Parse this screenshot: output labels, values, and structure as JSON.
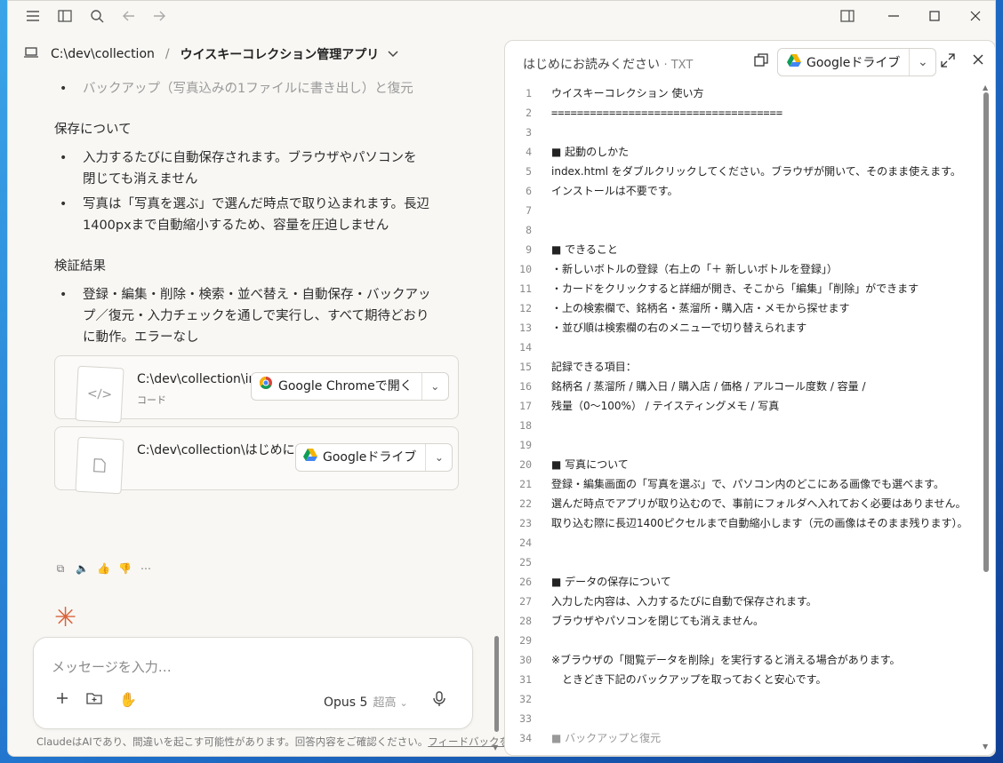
{
  "titlebar": {
    "menu_icon": "hamburger-icon",
    "sidebar_icon": "sidebar-toggle-icon",
    "search_icon": "search-icon",
    "back_icon": "arrow-left-icon",
    "forward_icon": "arrow-right-icon",
    "layout_icon": "split-view-icon",
    "minimize_icon": "minimize-icon",
    "maximize_icon": "maximize-icon",
    "close_icon": "close-icon"
  },
  "breadcrumb": {
    "path": "C:\\dev\\collection",
    "separator": "/",
    "project": "ウイスキーコレクション管理アプリ"
  },
  "chat": {
    "top_bullet": "バックアップ（写真込みの1ファイルに書き出し）と復元",
    "save_heading": "保存について",
    "save_bullets": [
      "入力するたびに自動保存されます。ブラウザやパソコンを閉じても消えません",
      "写真は「写真を選ぶ」で選んだ時点で取り込まれます。長辺1400pxまで自動縮小するため、容量を圧迫しません"
    ],
    "verify_heading": "検証結果",
    "verify_bullets": [
      "登録・編集・削除・検索・並べ替え・自動保存・バックアップ／復元・入力チェックを通しで実行し、すべて期待どおりに動作。エラーなし"
    ],
    "cards": [
      {
        "name": "C:\\dev\\collection\\in",
        "sub": "コード",
        "button": "Google Chromeで開く"
      },
      {
        "name": "C:\\dev\\collection\\はじめに…",
        "sub": "",
        "button": "Googleドライブ"
      }
    ]
  },
  "composer": {
    "placeholder": "メッセージを入力…",
    "model": "Opus 5",
    "effort": "超高"
  },
  "disclaimer": {
    "text": "ClaudeはAIであり、間違いを起こす可能性があります。回答内容をご確認ください。",
    "feedback": "フィードバックを送信"
  },
  "panel": {
    "title": "はじめにお読みください",
    "ext": "· TXT",
    "drive_button": "Googleドライブ",
    "lines": [
      "ウイスキーコレクション 使い方",
      "====================================",
      "",
      "■ 起動のしかた",
      "index.html をダブルクリックしてください。ブラウザが開いて、そのまま使えます。",
      "インストールは不要です。",
      "",
      "",
      "■ できること",
      "・新しいボトルの登録（右上の「＋ 新しいボトルを登録」）",
      "・カードをクリックすると詳細が開き、そこから「編集」「削除」ができます",
      "・上の検索欄で、銘柄名・蒸溜所・購入店・メモから探せます",
      "・並び順は検索欄の右のメニューで切り替えられます",
      "",
      "記録できる項目：",
      "銘柄名 / 蒸溜所 / 購入日 / 購入店 / 価格 / アルコール度数 / 容量 /",
      "残量（0〜100%） / テイスティングメモ / 写真",
      "",
      "",
      "■ 写真について",
      "登録・編集画面の「写真を選ぶ」で、パソコン内のどこにある画像でも選べます。",
      "選んだ時点でアプリが取り込むので、事前にフォルダへ入れておく必要はありません。",
      "取り込む際に長辺1400ピクセルまで自動縮小します（元の画像はそのまま残ります）。",
      "",
      "",
      "■ データの保存について",
      "入力した内容は、入力するたびに自動で保存されます。",
      "ブラウザやパソコンを閉じても消えません。",
      "",
      "※ブラウザの「閲覧データを削除」を実行すると消える場合があります。",
      "　ときどき下記のバックアップを取っておくと安心です。",
      "",
      "",
      "■ バックアップと復元"
    ]
  },
  "colors": {
    "accent": "#d9653a",
    "background": "#f8f7f4"
  }
}
